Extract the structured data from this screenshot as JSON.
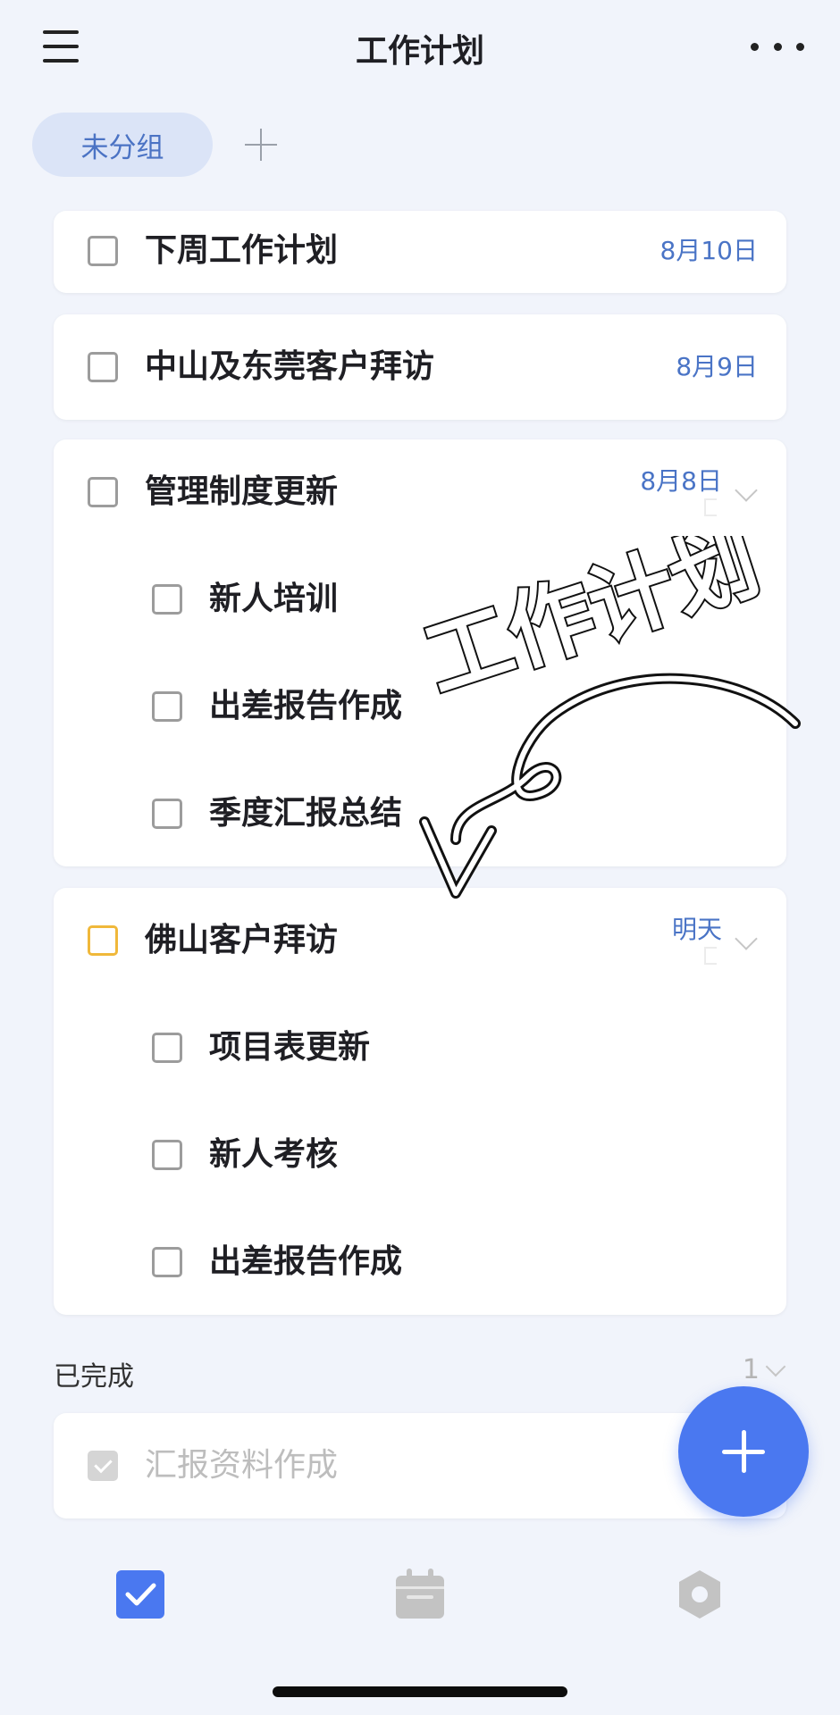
{
  "header": {
    "title": "工作计划",
    "menu_icon": "hamburger-icon",
    "more_icon": "ellipsis-icon"
  },
  "groups": {
    "active": "未分组",
    "add_icon": "plus-icon"
  },
  "cards": [
    {
      "title": "下周工作计划",
      "date": "8月10日"
    },
    {
      "title": "中山及东莞客户拜访",
      "date": "8月9日"
    },
    {
      "title": "管理制度更新",
      "date": "8月8日",
      "subtasks": [
        "新人培训",
        "出差报告作成",
        "季度汇报总结"
      ]
    },
    {
      "title": "佛山客户拜访",
      "date": "明天",
      "subtasks": [
        "项目表更新",
        "新人考核",
        "出差报告作成"
      ]
    }
  ],
  "completed": {
    "label": "已完成",
    "count": "1",
    "items": [
      "汇报资料作成"
    ]
  },
  "fab": {
    "icon": "plus-icon"
  },
  "tabbar": {
    "items": [
      "checkbox-icon",
      "calendar-icon",
      "hexagon-settings-icon"
    ]
  },
  "overlay_text": "工作计划",
  "colors": {
    "accent": "#4a78f0",
    "date": "#4a74c6",
    "chip_bg": "#dbe4f7",
    "pending_box": "#f0b83a"
  }
}
